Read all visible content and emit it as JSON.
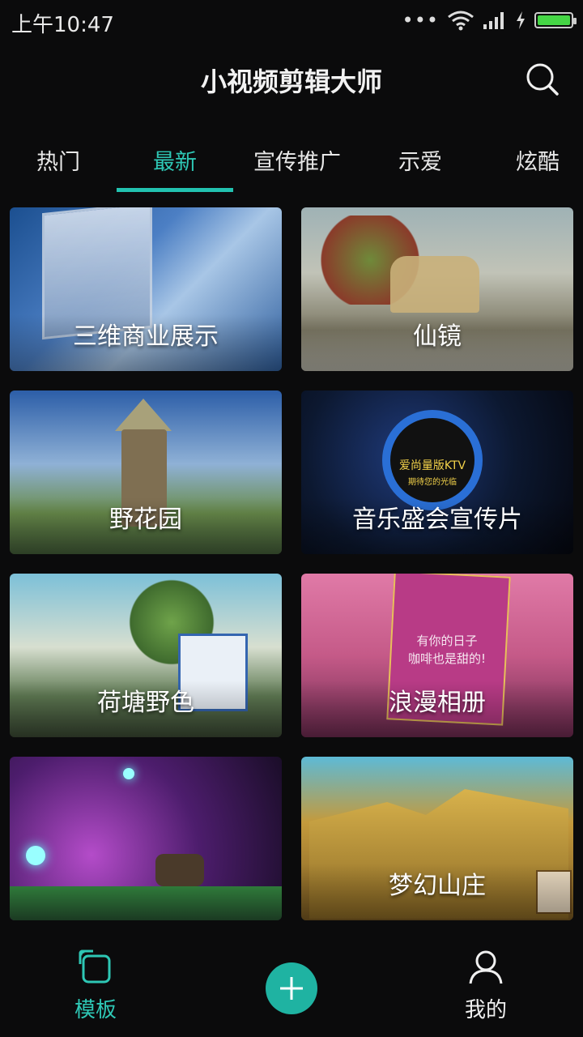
{
  "status_bar": {
    "time": "上午10:47",
    "signal_dots": "•••"
  },
  "header": {
    "title": "小视频剪辑大师",
    "search_icon": "search-icon"
  },
  "tabs": [
    {
      "label": "热门",
      "active": false
    },
    {
      "label": "最新",
      "active": true
    },
    {
      "label": "宣传推广",
      "active": false
    },
    {
      "label": "示爱",
      "active": false
    },
    {
      "label": "炫酷",
      "active": false
    }
  ],
  "cards": [
    {
      "title": "三维商业展示"
    },
    {
      "title": "仙镜"
    },
    {
      "title": "野花园"
    },
    {
      "title": "音乐盛会宣传片",
      "poster_text": "爱尚量版KTV",
      "poster_sub": "期待您的光临"
    },
    {
      "title": "荷塘野色"
    },
    {
      "title": "浪漫相册",
      "poster_text": "有你的日子",
      "poster_sub": "咖啡也是甜的!"
    },
    {
      "title": ""
    },
    {
      "title": "梦幻山庄"
    }
  ],
  "bottom_nav": {
    "templates_label": "模板",
    "mine_label": "我的",
    "accent": "#1fb3a2"
  }
}
